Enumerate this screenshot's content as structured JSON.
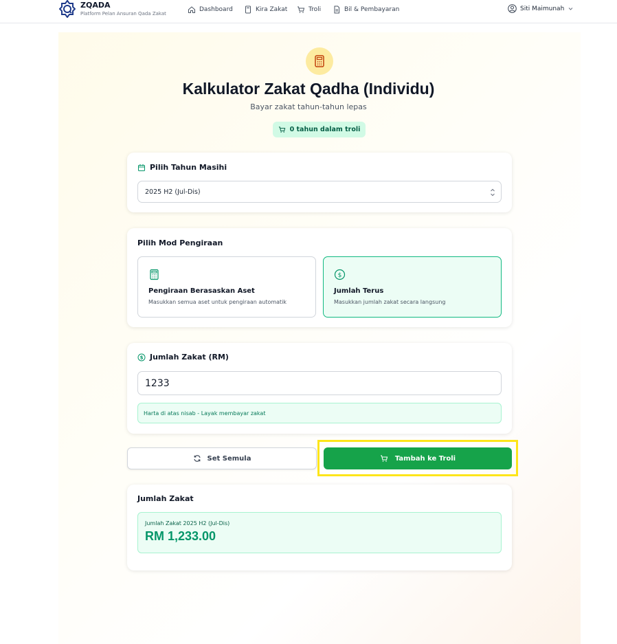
{
  "brand": {
    "name": "ZQADA",
    "tagline": "Platform Pelan Ansuran Qada Zakat"
  },
  "nav": {
    "items": [
      {
        "label": "Dashboard",
        "icon": "home-icon"
      },
      {
        "label": "Kira Zakat",
        "icon": "calculator-icon"
      },
      {
        "label": "Troli",
        "icon": "cart-icon"
      },
      {
        "label": "Bil & Pembayaran",
        "icon": "document-icon"
      }
    ],
    "user_name": "Siti Maimunah"
  },
  "page": {
    "title": "Kalkulator Zakat Qadha (Individu)",
    "subtitle": "Bayar zakat tahun-tahun lepas",
    "cart_badge": "0 tahun dalam troli"
  },
  "year_section": {
    "title": "Pilih Tahun Masihi",
    "selected": "2025 H2 (Jul-Dis)"
  },
  "mode_section": {
    "title": "Pilih Mod Pengiraan",
    "options": [
      {
        "label": "Pengiraan Berasaskan Aset",
        "description": "Masukkan semua aset untuk pengiraan automatik",
        "selected": false
      },
      {
        "label": "Jumlah Terus",
        "description": "Masukkan jumlah zakat secara langsung",
        "selected": true
      }
    ]
  },
  "amount_section": {
    "title": "Jumlah Zakat (RM)",
    "value": "1233",
    "nisab_note": "Harta di atas nisab - Layak membayar zakat"
  },
  "actions": {
    "reset_label": "Set Semula",
    "add_label": "Tambah ke Troli"
  },
  "summary": {
    "title": "Jumlah Zakat",
    "label": "Jumlah Zakat 2025 H2 (Jul-Dis)",
    "value": "RM 1,233.00"
  },
  "colors": {
    "accent": "#16a34a",
    "accent_light": "#ecfdf5",
    "highlight": "#fde51a"
  }
}
